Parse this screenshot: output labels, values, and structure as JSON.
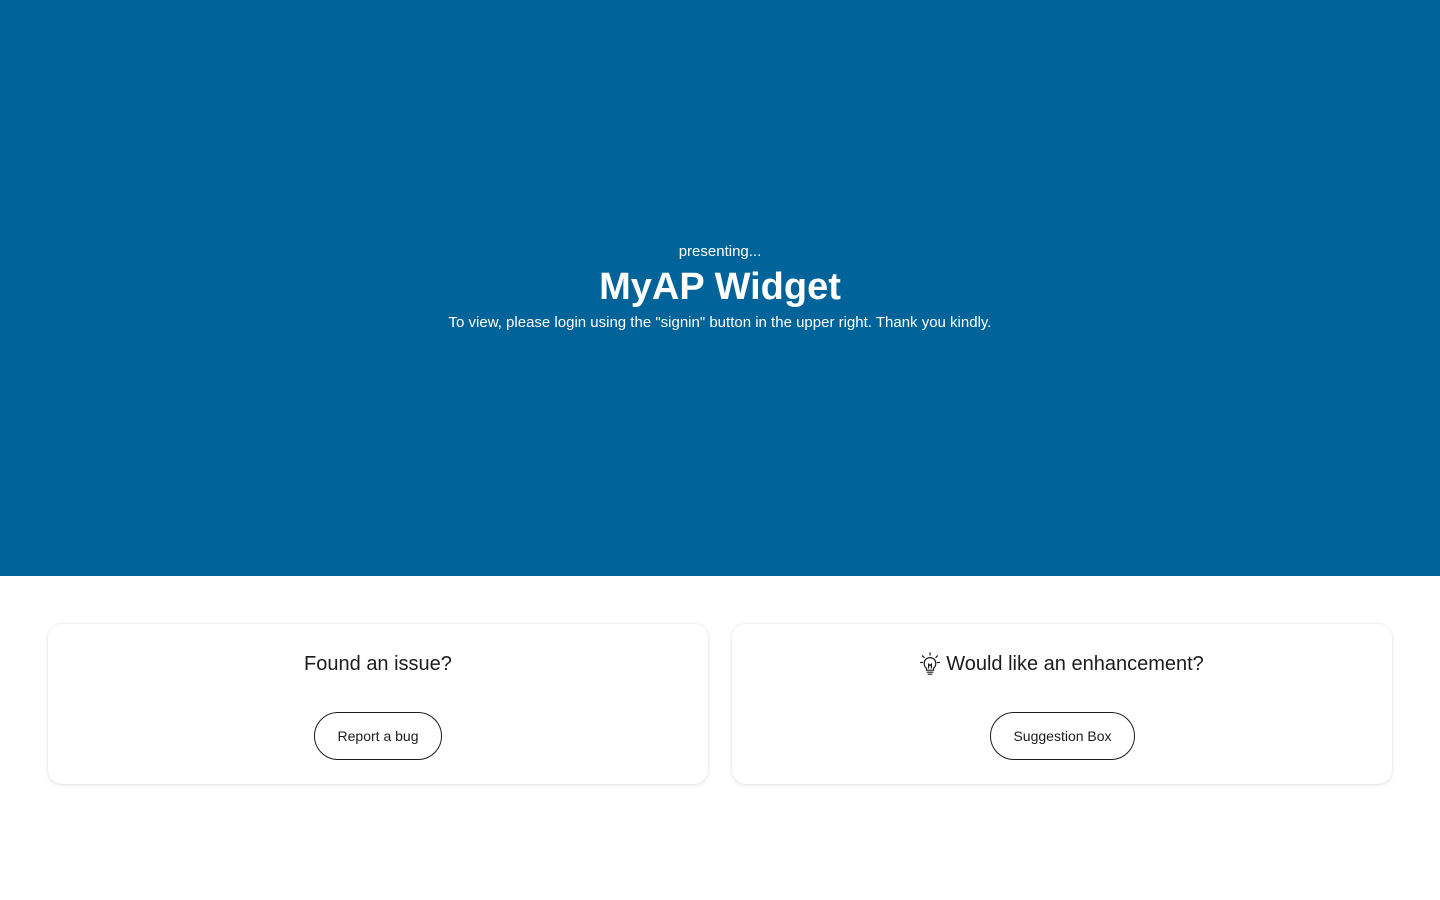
{
  "hero": {
    "presenting": "presenting...",
    "title": "MyAP Widget",
    "instructions": "To view, please login using the \"signin\" button in the upper right. Thank you kindly.",
    "background_color": "#006399"
  },
  "cards": {
    "issue": {
      "heading": "Found an issue?",
      "button_label": "Report a bug"
    },
    "enhancement": {
      "icon": "lightbulb-icon",
      "heading": "Would like an enhancement?",
      "button_label": "Suggestion Box"
    }
  }
}
